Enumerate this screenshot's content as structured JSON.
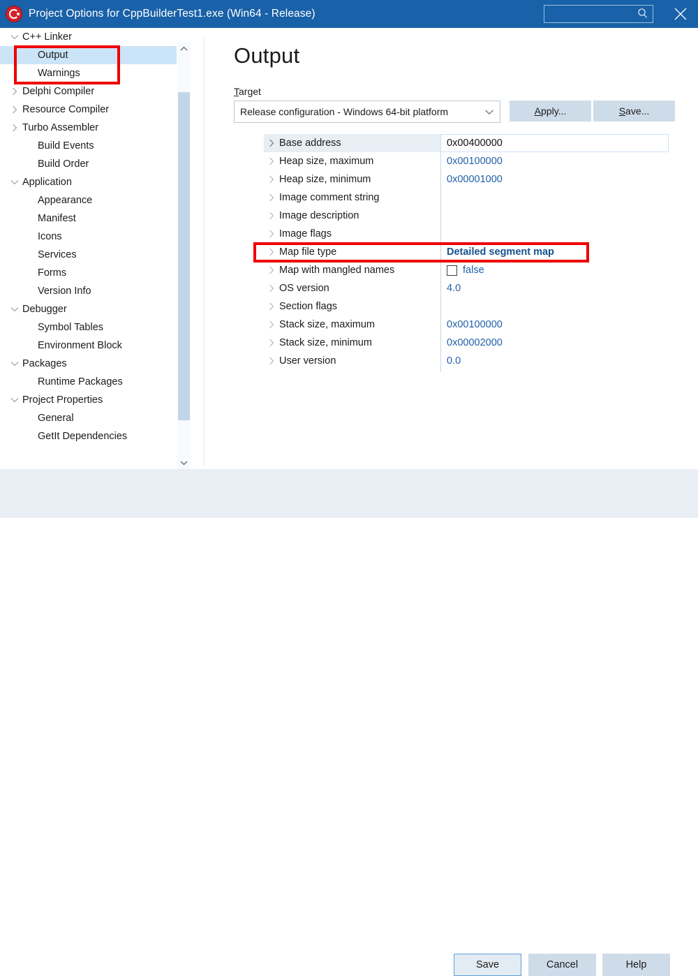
{
  "window": {
    "title": "Project Options for CppBuilderTest1.exe  (Win64 - Release)",
    "app_icon": "cpp-builder-logo-icon",
    "search": {
      "value": "",
      "placeholder": "",
      "icon": "search-icon"
    },
    "close_icon": "close-icon",
    "titlebar_color": "#1961a8"
  },
  "sidebar": {
    "scroll": {
      "up_icon": "chevron-up-icon",
      "down_icon": "chevron-down-icon"
    },
    "items": [
      {
        "label": "C++ Linker",
        "level": 0,
        "arrow": "chevron-down-icon",
        "selected": false
      },
      {
        "label": "Output",
        "level": 1,
        "arrow": "",
        "selected": true
      },
      {
        "label": "Warnings",
        "level": 1,
        "arrow": "",
        "selected": false
      },
      {
        "label": "Delphi Compiler",
        "level": 0,
        "arrow": "chevron-right-icon",
        "selected": false
      },
      {
        "label": "Resource Compiler",
        "level": 0,
        "arrow": "chevron-right-icon",
        "selected": false
      },
      {
        "label": "Turbo Assembler",
        "level": 0,
        "arrow": "chevron-right-icon",
        "selected": false
      },
      {
        "label": "Build Events",
        "level": 1,
        "arrow": "",
        "selected": false
      },
      {
        "label": "Build Order",
        "level": 1,
        "arrow": "",
        "selected": false
      },
      {
        "label": "Application",
        "level": 0,
        "arrow": "chevron-down-icon",
        "selected": false
      },
      {
        "label": "Appearance",
        "level": 1,
        "arrow": "",
        "selected": false
      },
      {
        "label": "Manifest",
        "level": 1,
        "arrow": "",
        "selected": false
      },
      {
        "label": "Icons",
        "level": 1,
        "arrow": "",
        "selected": false
      },
      {
        "label": "Services",
        "level": 1,
        "arrow": "",
        "selected": false
      },
      {
        "label": "Forms",
        "level": 1,
        "arrow": "",
        "selected": false
      },
      {
        "label": "Version Info",
        "level": 1,
        "arrow": "",
        "selected": false
      },
      {
        "label": "Debugger",
        "level": 0,
        "arrow": "chevron-down-icon",
        "selected": false
      },
      {
        "label": "Symbol Tables",
        "level": 1,
        "arrow": "",
        "selected": false
      },
      {
        "label": "Environment Block",
        "level": 1,
        "arrow": "",
        "selected": false
      },
      {
        "label": "Packages",
        "level": 0,
        "arrow": "chevron-down-icon",
        "selected": false
      },
      {
        "label": "Runtime Packages",
        "level": 1,
        "arrow": "",
        "selected": false
      },
      {
        "label": "Project Properties",
        "level": 0,
        "arrow": "chevron-down-icon",
        "selected": false
      },
      {
        "label": "General",
        "level": 1,
        "arrow": "",
        "selected": false
      },
      {
        "label": "GetIt Dependencies",
        "level": 1,
        "arrow": "",
        "selected": false
      }
    ]
  },
  "main": {
    "page_title": "Output",
    "target": {
      "label_prefix": "T",
      "label_rest": "arget",
      "selected_option": "Release configuration - Windows 64-bit platform",
      "dropdown_icon": "chevron-down-icon"
    },
    "apply_button": {
      "accel": "A",
      "rest": "pply..."
    },
    "save_button": {
      "accel": "S",
      "rest": "ave..."
    },
    "properties": [
      {
        "name": "Base address",
        "value": "0x00400000",
        "type": "text",
        "focused": true,
        "bold": false
      },
      {
        "name": "Heap size, maximum",
        "value": "0x00100000",
        "type": "text",
        "focused": false,
        "bold": false
      },
      {
        "name": "Heap size, minimum",
        "value": "0x00001000",
        "type": "text",
        "focused": false,
        "bold": false
      },
      {
        "name": "Image comment string",
        "value": "",
        "type": "text",
        "focused": false,
        "bold": false
      },
      {
        "name": "Image description",
        "value": "",
        "type": "text",
        "focused": false,
        "bold": false
      },
      {
        "name": "Image flags",
        "value": "",
        "type": "text",
        "focused": false,
        "bold": false
      },
      {
        "name": "Map file type",
        "value": "Detailed segment map",
        "type": "text",
        "focused": false,
        "bold": true
      },
      {
        "name": "Map with mangled names",
        "value": "false",
        "type": "checkbox",
        "checked": false,
        "focused": false,
        "bold": false
      },
      {
        "name": "OS version",
        "value": "4.0",
        "type": "text",
        "focused": false,
        "bold": false
      },
      {
        "name": "Section flags",
        "value": "",
        "type": "text",
        "focused": false,
        "bold": false
      },
      {
        "name": "Stack size, maximum",
        "value": "0x00100000",
        "type": "text",
        "focused": false,
        "bold": false
      },
      {
        "name": "Stack size, minimum",
        "value": "0x00002000",
        "type": "text",
        "focused": false,
        "bold": false
      },
      {
        "name": "User version",
        "value": "0.0",
        "type": "text",
        "focused": false,
        "bold": false
      }
    ],
    "row_expand_icon": "chevron-right-icon"
  },
  "annotations": [
    {
      "name": "sidebar-output-highlight",
      "color": "#ee0000"
    },
    {
      "name": "map-file-type-highlight",
      "color": "#ee0000"
    }
  ],
  "footer": {
    "save_label": "Save",
    "cancel_label": "Cancel",
    "help_label": "Help"
  }
}
